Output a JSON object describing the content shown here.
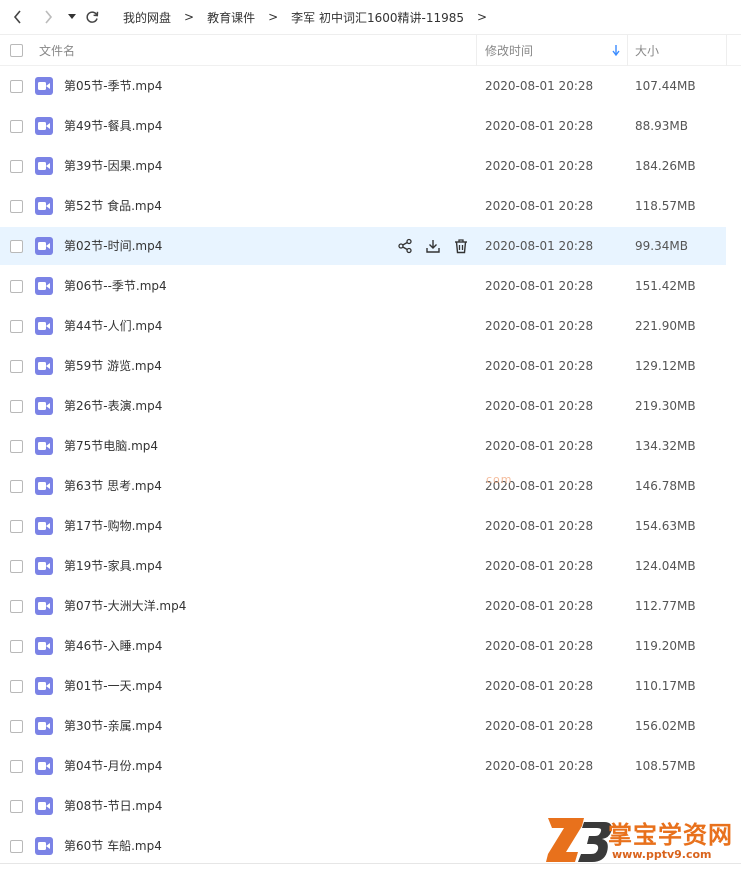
{
  "nav": {
    "back_icon": "chevron-left-icon",
    "forward_icon": "chevron-right-icon",
    "history_icon": "caret-down-icon",
    "refresh_icon": "refresh-icon"
  },
  "breadcrumb": [
    {
      "label": "我的网盘"
    },
    {
      "label": "教育课件"
    },
    {
      "label": "李军 初中词汇1600精讲-11985"
    }
  ],
  "breadcrumb_separator": ">",
  "columns": {
    "name": "文件名",
    "modified": "修改时间",
    "size": "大小",
    "sort_icon": "sort-down-arrow-icon"
  },
  "hovered_row_actions": [
    "share-icon",
    "download-icon",
    "delete-icon"
  ],
  "files": [
    {
      "name": "第05节-季节.mp4",
      "modified": "2020-08-01 20:28",
      "size": "107.44MB"
    },
    {
      "name": "第49节-餐具.mp4",
      "modified": "2020-08-01 20:28",
      "size": "88.93MB"
    },
    {
      "name": "第39节-因果.mp4",
      "modified": "2020-08-01 20:28",
      "size": "184.26MB"
    },
    {
      "name": "第52节 食品.mp4",
      "modified": "2020-08-01 20:28",
      "size": "118.57MB"
    },
    {
      "name": "第02节-时间.mp4",
      "modified": "2020-08-01 20:28",
      "size": "99.34MB"
    },
    {
      "name": "第06节--季节.mp4",
      "modified": "2020-08-01 20:28",
      "size": "151.42MB"
    },
    {
      "name": "第44节-人们.mp4",
      "modified": "2020-08-01 20:28",
      "size": "221.90MB"
    },
    {
      "name": "第59节 游览.mp4",
      "modified": "2020-08-01 20:28",
      "size": "129.12MB"
    },
    {
      "name": "第26节-表演.mp4",
      "modified": "2020-08-01 20:28",
      "size": "219.30MB"
    },
    {
      "name": "第75节电脑.mp4",
      "modified": "2020-08-01 20:28",
      "size": "134.32MB"
    },
    {
      "name": "第63节 思考.mp4",
      "modified": "2020-08-01 20:28",
      "size": "146.78MB"
    },
    {
      "name": "第17节-购物.mp4",
      "modified": "2020-08-01 20:28",
      "size": "154.63MB"
    },
    {
      "name": "第19节-家具.mp4",
      "modified": "2020-08-01 20:28",
      "size": "124.04MB"
    },
    {
      "name": "第07节-大洲大洋.mp4",
      "modified": "2020-08-01 20:28",
      "size": "112.77MB"
    },
    {
      "name": "第46节-入睡.mp4",
      "modified": "2020-08-01 20:28",
      "size": "119.20MB"
    },
    {
      "name": "第01节-一天.mp4",
      "modified": "2020-08-01 20:28",
      "size": "110.17MB"
    },
    {
      "name": "第30节-亲属.mp4",
      "modified": "2020-08-01 20:28",
      "size": "156.02MB"
    },
    {
      "name": "第04节-月份.mp4",
      "modified": "2020-08-01 20:28",
      "size": "108.57MB"
    },
    {
      "name": "第08节-节日.mp4",
      "modified": "",
      "size": ""
    },
    {
      "name": "第60节 车船.mp4",
      "modified": "",
      "size": ""
    }
  ],
  "watermark": {
    "center_text": "com",
    "logo_title": "掌宝学资网",
    "logo_url": "www.pptv9.com"
  },
  "colors": {
    "file_icon": "#7b83e6",
    "hover_row": "#e8f4ff",
    "sort_arrow": "#3b8cff",
    "watermark": "#e8711c"
  }
}
